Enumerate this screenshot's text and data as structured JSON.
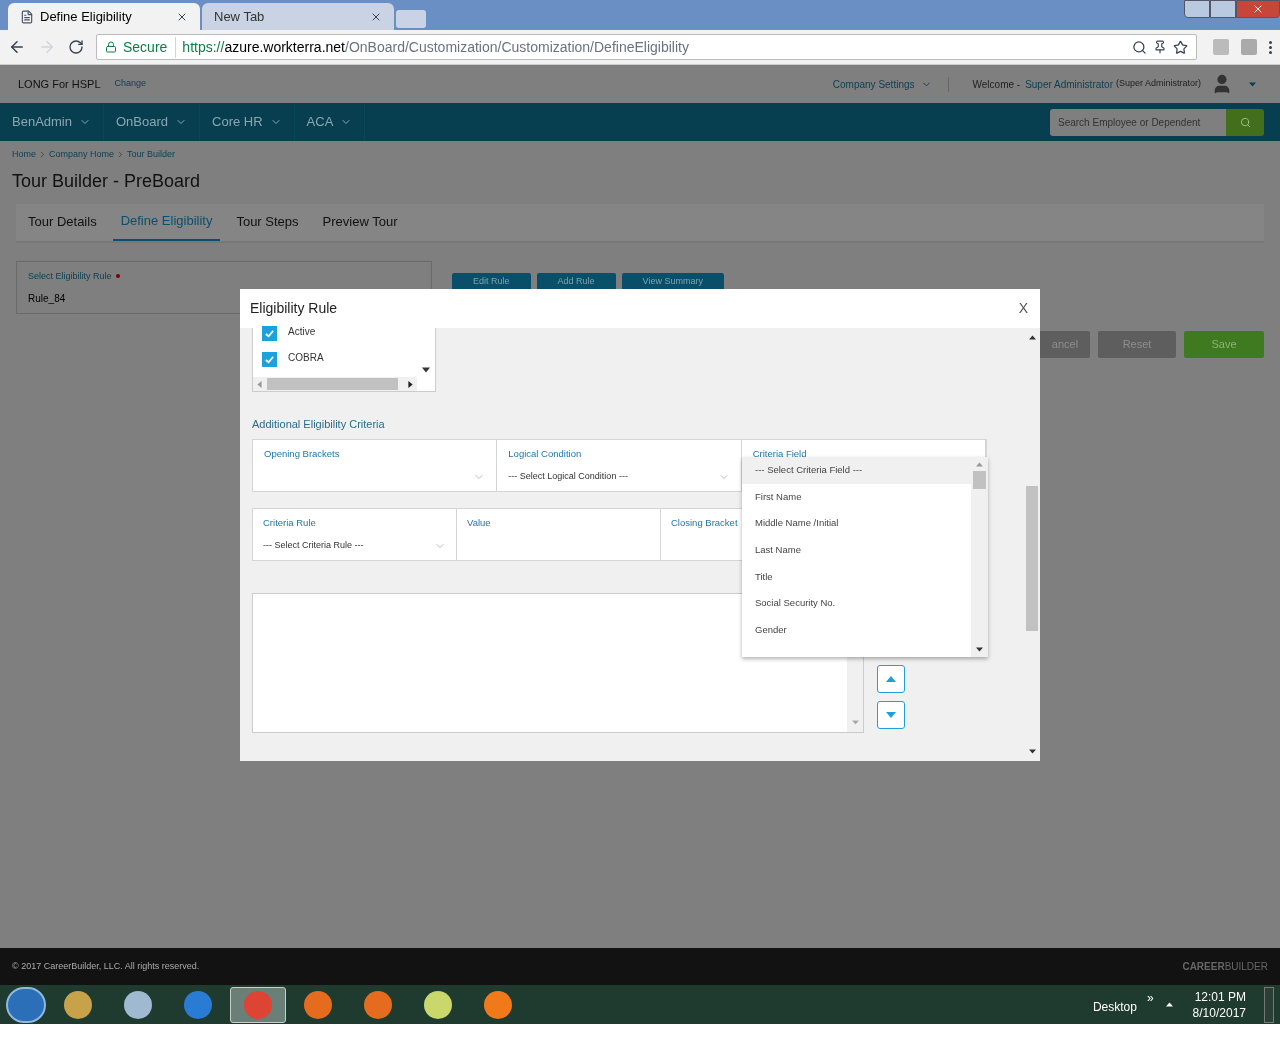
{
  "browser": {
    "tabs": [
      {
        "title": "Define Eligibility",
        "selected": true
      },
      {
        "title": "New Tab",
        "selected": false
      }
    ],
    "secure_label": "Secure",
    "url_scheme": "https://",
    "url_host": "azure.workterra.net",
    "url_path": "/OnBoard/Customization/Customization/DefineEligibility"
  },
  "header": {
    "company": "LONG For HSPL",
    "change": "Change",
    "company_settings": "Company Settings",
    "welcome": "Welcome -",
    "user": "Super Administrator",
    "role": "(Super Administrator)"
  },
  "nav": {
    "items": [
      "BenAdmin",
      "OnBoard",
      "Core HR",
      "ACA"
    ],
    "search_placeholder": "Search Employee or Dependent"
  },
  "breadcrumbs": [
    "Home",
    "Company Home",
    "Tour Builder"
  ],
  "page_title": "Tour Builder - PreBoard",
  "tabs": [
    {
      "label": "Tour Details",
      "selected": false
    },
    {
      "label": "Define Eligibility",
      "selected": true
    },
    {
      "label": "Tour Steps",
      "selected": false
    },
    {
      "label": "Preview Tour",
      "selected": false
    }
  ],
  "rule_select": {
    "label": "Select Eligibility Rule",
    "required": true,
    "value": "Rule_84"
  },
  "rule_buttons": [
    "Edit Rule",
    "Add Rule",
    "View Summary"
  ],
  "form_buttons": [
    {
      "label": "ancel",
      "kind": "secondary"
    },
    {
      "label": "Reset",
      "kind": "secondary"
    },
    {
      "label": "Save",
      "kind": "primary"
    }
  ],
  "modal": {
    "title": "Eligibility Rule",
    "close": "X",
    "checkboxes": [
      {
        "label": "Active",
        "checked": true
      },
      {
        "label": "COBRA",
        "checked": true
      }
    ],
    "section_title": "Additional Eligibility Criteria",
    "row1": [
      {
        "label": "Opening Brackets"
      },
      {
        "label": "Logical Condition",
        "value": "--- Select Logical Condition ---"
      },
      {
        "label": "Criteria Field"
      }
    ],
    "row2": [
      {
        "label": "Criteria Rule",
        "value": "--- Select Criteria Rule ---",
        "kind": "select"
      },
      {
        "label": "Value",
        "kind": "text"
      },
      {
        "label": "Closing Bracket",
        "kind": "text"
      }
    ],
    "options": [
      {
        "label": "--- Select Criteria Field ---",
        "selected": true
      },
      {
        "label": "First Name",
        "selected": false
      },
      {
        "label": "Middle Name /Initial",
        "selected": false
      },
      {
        "label": "Last Name",
        "selected": false
      },
      {
        "label": "Title",
        "selected": false
      },
      {
        "label": "Social Security No.",
        "selected": false
      },
      {
        "label": "Gender",
        "selected": false
      }
    ]
  },
  "footer": {
    "copyright": "© 2017 CareerBuilder, LLC. All rights reserved.",
    "brand": "**CAREER**BUILDER"
  },
  "taskbar": {
    "desktop": "Desktop",
    "chevron": "»",
    "time": "12:01 PM",
    "date": "8/10/2017"
  }
}
